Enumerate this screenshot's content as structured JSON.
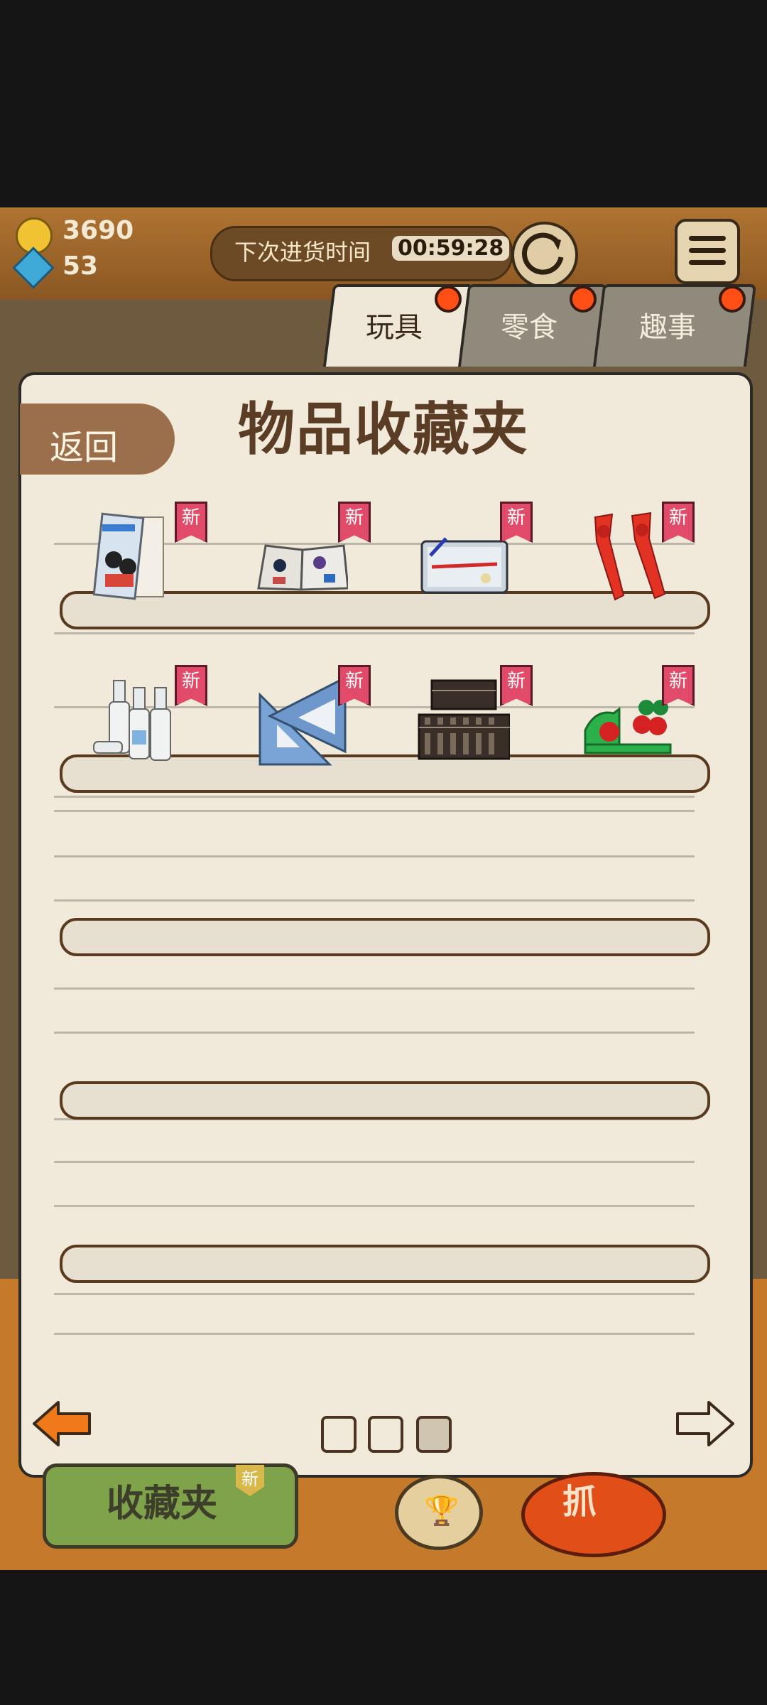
{
  "hud": {
    "coins": "3690",
    "gems": "53",
    "restock_label": "下次进货时间",
    "restock_timer": "00:59:28"
  },
  "tabs": [
    {
      "label": "玩具",
      "active": true
    },
    {
      "label": "零食",
      "active": false
    },
    {
      "label": "趣事",
      "active": false
    }
  ],
  "panel": {
    "title": "物品收藏夹",
    "back_label": "返回",
    "new_badge": "新"
  },
  "shelves": [
    {
      "items": [
        "notebook-item",
        "sticker-book-item",
        "pencil-case-item",
        "red-scarf-item"
      ]
    },
    {
      "items": [
        "glue-bottles-item",
        "triangle-rulers-item",
        "abacus-item",
        "stamp-item"
      ]
    },
    {
      "items": []
    },
    {
      "items": []
    },
    {
      "items": []
    }
  ],
  "pagination": {
    "total": 3,
    "current": 3
  },
  "background": {
    "collect_label": "收藏夹",
    "collect_badge": "新",
    "grab_label": "抓"
  },
  "colors": {
    "accent_orange": "#f07a1a",
    "badge_pink": "#e24a6a",
    "tab_dot": "#ff4f14",
    "panel_bg": "#f1eadb"
  }
}
